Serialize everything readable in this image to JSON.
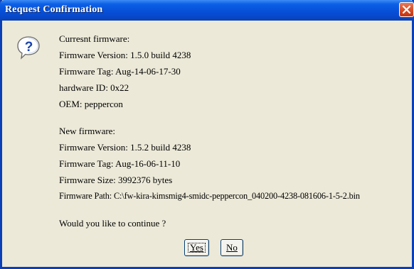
{
  "dialog": {
    "title": "Request Confirmation"
  },
  "current_firmware": {
    "heading": "Curresnt firmware:",
    "version": "Firmware Version: 1.5.0  build 4238",
    "tag": "Firmware Tag: Aug-14-06-17-30",
    "hardware_id": "hardware ID: 0x22",
    "oem": "OEM: peppercon"
  },
  "new_firmware": {
    "heading": "New firmware:",
    "version": "Firmware Version: 1.5.2  build 4238",
    "tag": "Firmware Tag: Aug-16-06-11-10",
    "size": "Firmware Size: 3992376 bytes",
    "path": "Firmware Path: C:\\fw-kira-kimsmig4-smidc-peppercon_040200-4238-081606-1-5-2.bin"
  },
  "prompt": "Would you like to continue ?",
  "buttons": {
    "yes_label": "Yes",
    "no_label": "No"
  },
  "icons": {
    "dialog_icon": "question-icon",
    "close": "close-icon"
  },
  "colors": {
    "titlebar": "#0650d8",
    "close_button": "#d6471f",
    "dialog_background": "#ece9d8"
  }
}
